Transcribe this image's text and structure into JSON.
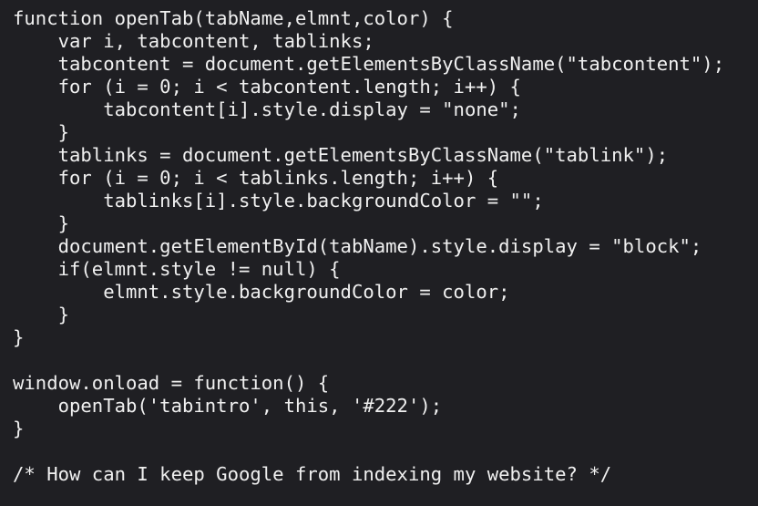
{
  "editor": {
    "lines": [
      "function openTab(tabName,elmnt,color) {",
      "    var i, tabcontent, tablinks;",
      "    tabcontent = document.getElementsByClassName(\"tabcontent\");",
      "    for (i = 0; i < tabcontent.length; i++) {",
      "        tabcontent[i].style.display = \"none\";",
      "    }",
      "    tablinks = document.getElementsByClassName(\"tablink\");",
      "    for (i = 0; i < tablinks.length; i++) {",
      "        tablinks[i].style.backgroundColor = \"\";",
      "    }",
      "    document.getElementById(tabName).style.display = \"block\";",
      "    if(elmnt.style != null) {",
      "        elmnt.style.backgroundColor = color;",
      "    }",
      "}",
      "",
      "window.onload = function() {",
      "    openTab('tabintro', this, '#222');",
      "}",
      "",
      "/* How can I keep Google from indexing my website? */"
    ]
  },
  "colors": {
    "background": "#1f1f23",
    "text": "#f0f0f0"
  }
}
